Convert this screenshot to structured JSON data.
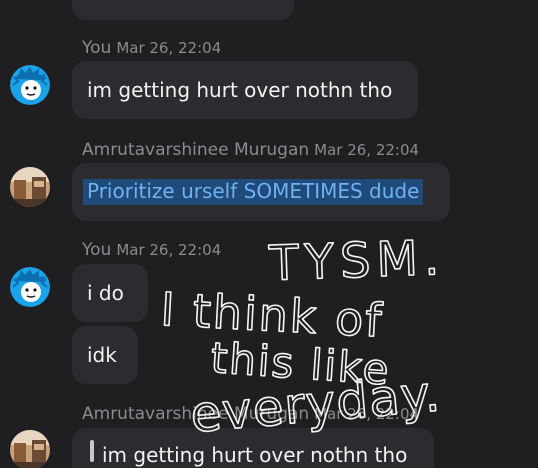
{
  "messages": {
    "m1": {
      "sender": "You",
      "timestamp": "Mar 26, 22:04",
      "text": "im getting hurt over nothn tho"
    },
    "m2": {
      "sender": "Amrutavarshinee Murugan",
      "timestamp": "Mar 26, 22:04",
      "text": "Prioritize urself SOMETIMES dude"
    },
    "m3": {
      "sender": "You",
      "timestamp": "Mar 26, 22:04",
      "texts": [
        "i do",
        "idk"
      ]
    },
    "m4": {
      "sender": "Amrutavarshinee Murugan",
      "timestamp": "Mar 26, 22:04",
      "quoted_text": "im getting hurt over nothn tho"
    }
  },
  "annotation": {
    "lines": [
      "TYSM.",
      "I think of",
      "this like",
      "everyday."
    ]
  },
  "colors": {
    "background": "#1f1f22",
    "bubble": "#2b2c2f",
    "selection": "#1f4a7a",
    "selected_text": "#6fb2f2",
    "meta": "#8b8b8f",
    "avatar_blue": "#1aa3e8"
  },
  "icons": {
    "self_avatar": "blue-spiky-cartoon-avatar",
    "other_avatar": "photo-avatar"
  }
}
